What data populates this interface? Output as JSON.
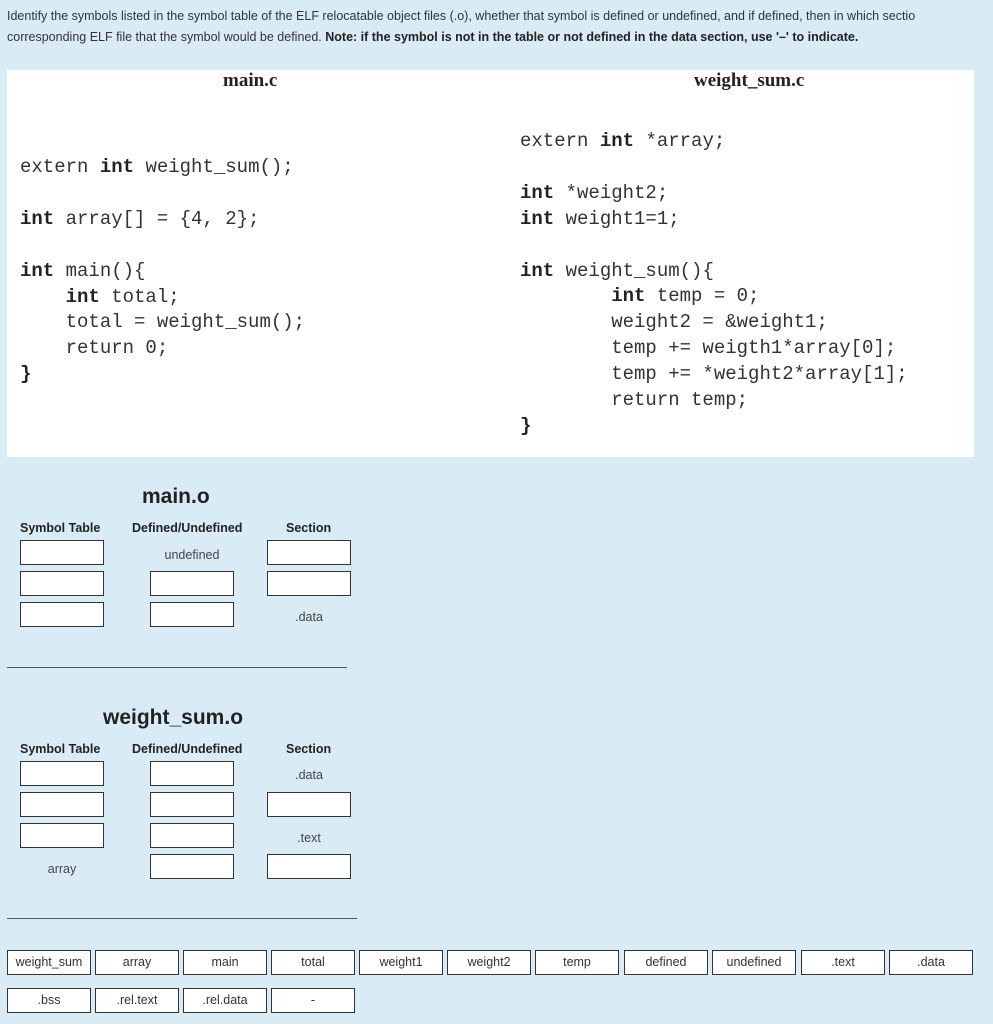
{
  "instructions": {
    "line1": "Identify the symbols listed in the symbol table of the ELF relocatable object files (.o), whether that symbol is defined or undefined, and if defined, then in which sectio",
    "line2_plain": "corresponding ELF file that the symbol would be defined. ",
    "line2_bold": "Note: if the symbol is not in the table or not defined in the data section, use '–' to indicate."
  },
  "code": {
    "main_title": "main.c",
    "weight_title": "weight_sum.c"
  },
  "main_o": {
    "title": "main.o",
    "headers": {
      "symbol": "Symbol Table",
      "defined": "Defined/Undefined",
      "section": "Section"
    },
    "row1_defined": "undefined",
    "row3_section": ".data"
  },
  "weight_o": {
    "title": "weight_sum.o",
    "headers": {
      "symbol": "Symbol Table",
      "defined": "Defined/Undefined",
      "section": "Section"
    },
    "row1_section": ".data",
    "row3_section": ".text",
    "row4_symbol": "array"
  },
  "chips": [
    "weight_sum",
    "array",
    "main",
    "total",
    "weight1",
    "weight2",
    "temp",
    "defined",
    "undefined",
    ".text",
    ".data",
    ".bss",
    ".rel.text",
    ".rel.data",
    "-"
  ]
}
